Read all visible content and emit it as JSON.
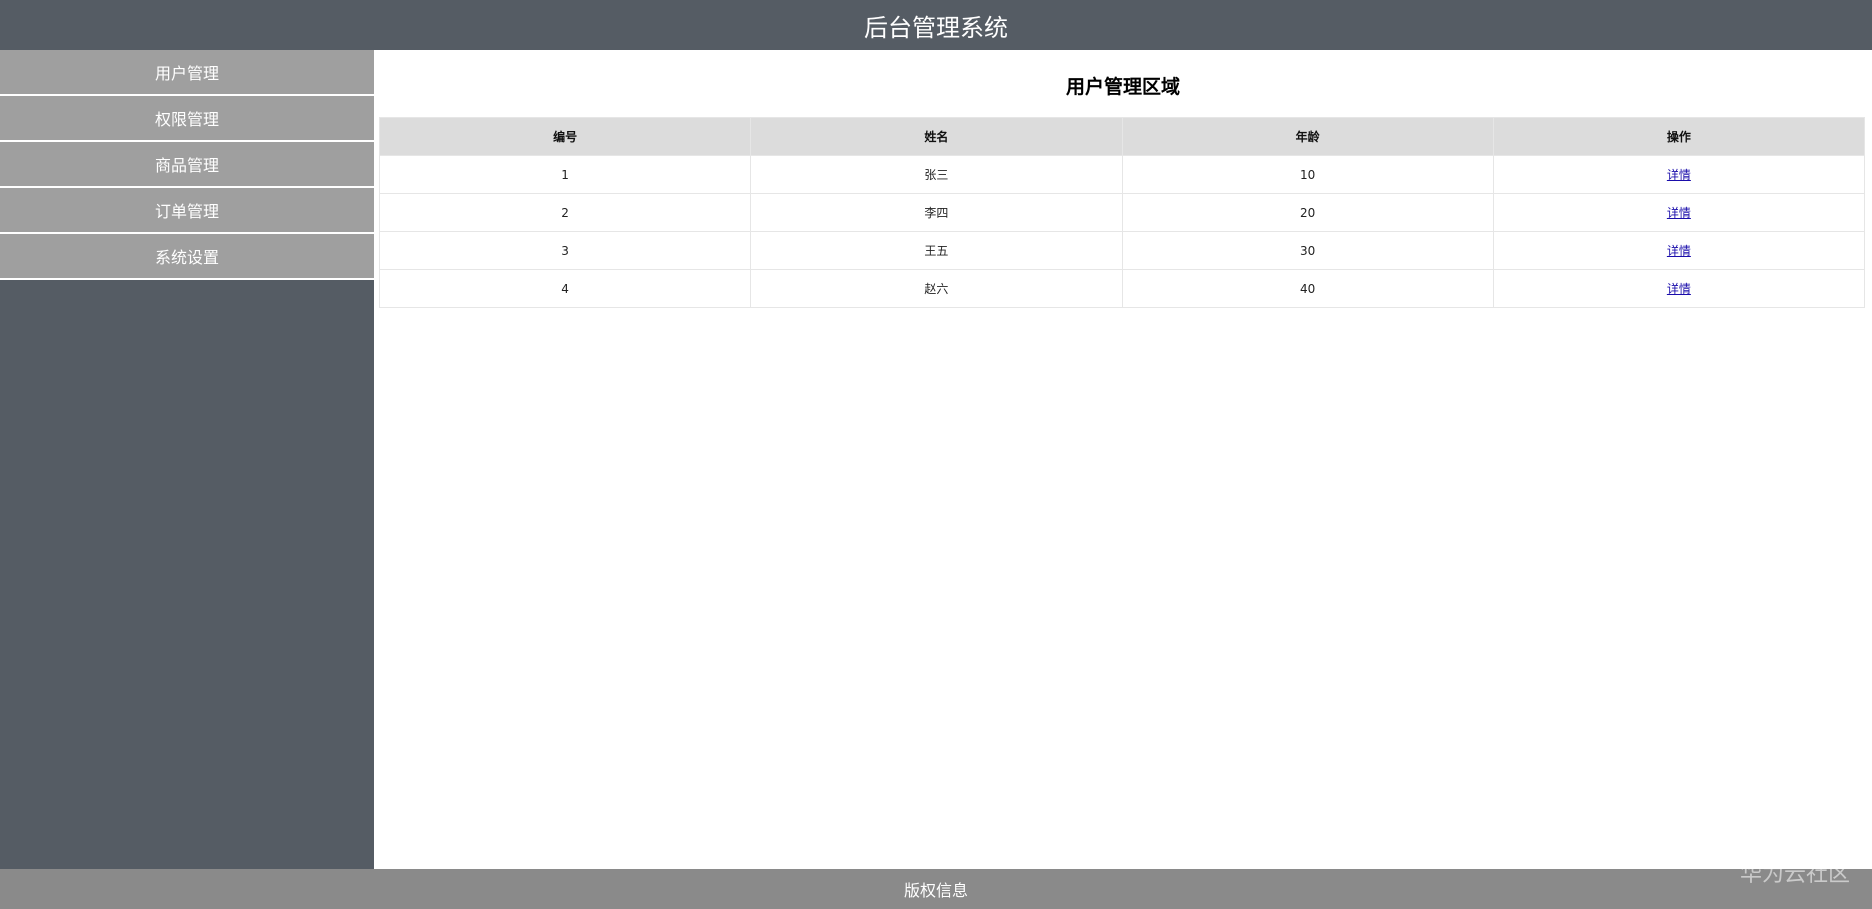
{
  "header": {
    "title": "后台管理系统",
    "bg_color": "#555c64"
  },
  "sidebar": {
    "items": [
      {
        "label": "用户管理"
      },
      {
        "label": "权限管理"
      },
      {
        "label": "商品管理"
      },
      {
        "label": "订单管理"
      },
      {
        "label": "系统设置"
      }
    ],
    "item_color": "#9f9f9f"
  },
  "main": {
    "title": "用户管理区域",
    "table": {
      "headers": [
        "编号",
        "姓名",
        "年龄",
        "操作"
      ],
      "rows": [
        {
          "id": "1",
          "name": "张三",
          "age": "10",
          "action": "详情"
        },
        {
          "id": "2",
          "name": "李四",
          "age": "20",
          "action": "详情"
        },
        {
          "id": "3",
          "name": "王五",
          "age": "30",
          "action": "详情"
        },
        {
          "id": "4",
          "name": "赵六",
          "age": "40",
          "action": "详情"
        }
      ],
      "header_bg": "#dcdcdc"
    }
  },
  "footer": {
    "text": "版权信息",
    "bg_color": "#8a8a8a"
  },
  "watermark": {
    "text": "华为云社区"
  }
}
